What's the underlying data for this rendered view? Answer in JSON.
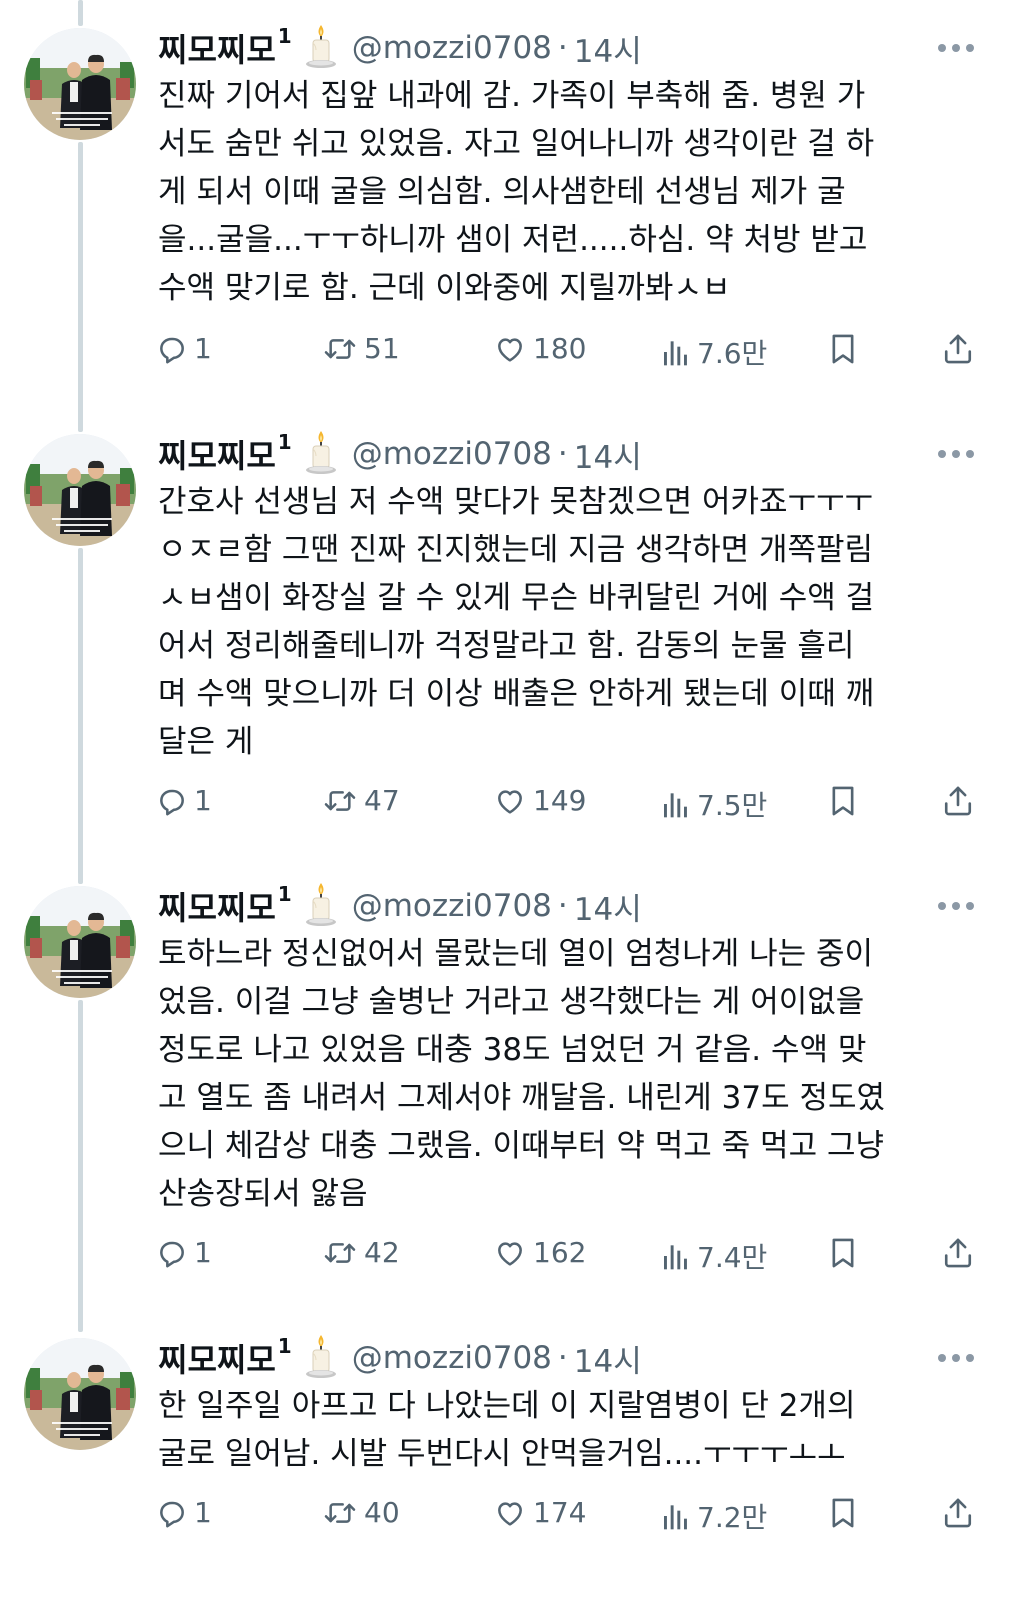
{
  "tweets": [
    {
      "name": "찌모찌모",
      "sup": "1",
      "handle": "@mozzi0708",
      "separator": "·",
      "time": "14시",
      "lines": [
        "진짜 기어서 집앞 내과에 감. 가족이 부축해 줌. 병원 가",
        "서도 숨만 쉬고 있었음. 자고 일어나니까 생각이란 걸 하",
        "게 되서 이때 굴을 의심함. 의사샘한테 선생님 제가 굴",
        "을...굴을...ㅜㅜ하니까 샘이 저런.....하심. 약 처방 받고",
        "수액 맞기로 함. 근데 이와중에 지릴까봐ㅅㅂ"
      ],
      "replies": "1",
      "reposts": "51",
      "likes": "180",
      "views": "7.6만"
    },
    {
      "name": "찌모찌모",
      "sup": "1",
      "handle": "@mozzi0708",
      "separator": "·",
      "time": "14시",
      "lines": [
        "간호사 선생님 저 수액 맞다가 못참겠으면 어카죠ㅜㅜㅜ",
        "ㅇㅈㄹ함 그땐 진짜 진지했는데 지금 생각하면 개쪽팔림",
        "ㅅㅂ샘이 화장실 갈 수 있게 무슨 바퀴달린 거에 수액 걸",
        "어서 정리해줄테니까 걱정말라고 함. 감동의 눈물 흘리",
        "며 수액 맞으니까 더 이상 배출은 안하게 됐는데 이때 깨",
        "달은 게"
      ],
      "replies": "1",
      "reposts": "47",
      "likes": "149",
      "views": "7.5만"
    },
    {
      "name": "찌모찌모",
      "sup": "1",
      "handle": "@mozzi0708",
      "separator": "·",
      "time": "14시",
      "lines": [
        "토하느라 정신없어서 몰랐는데 열이 엄청나게 나는 중이",
        "었음. 이걸 그냥 술병난 거라고 생각했다는 게 어이없을",
        "정도로 나고 있었음 대충 38도 넘었던 거 같음. 수액 맞",
        "고 열도 좀 내려서 그제서야 깨달음. 내린게 37도 정도였",
        "으니 체감상 대충 그랬음. 이때부터 약 먹고 죽 먹고 그냥",
        "산송장되서 앓음"
      ],
      "replies": "1",
      "reposts": "42",
      "likes": "162",
      "views": "7.4만"
    },
    {
      "name": "찌모찌모",
      "sup": "1",
      "handle": "@mozzi0708",
      "separator": "·",
      "time": "14시",
      "lines": [
        "한 일주일 아프고 다 나았는데 이 지랄염병이 단 2개의",
        "굴로 일어남. 시발 두번다시 안먹을거임....ㅜㅜㅜㅗㅗ"
      ],
      "replies": "1",
      "reposts": "40",
      "likes": "174",
      "views": "7.2만"
    }
  ],
  "icons": {
    "reply": "reply-icon",
    "repost": "repost-icon",
    "like": "heart-icon",
    "views": "views-icon",
    "bookmark": "bookmark-icon",
    "share": "share-icon",
    "more": "more-icon",
    "candle": "candle-emoji-icon"
  },
  "colors": {
    "text": "#0f1419",
    "secondary": "#536471",
    "thread_line": "#cfd9de"
  }
}
